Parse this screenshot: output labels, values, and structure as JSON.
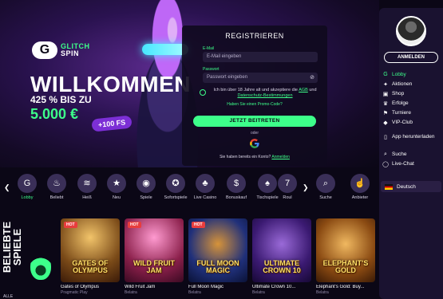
{
  "hero": {
    "logo_mark": "G",
    "logo_line1": "GLITCH",
    "logo_line2": "SPIN",
    "welcome": "WILLKOMMEN",
    "subtitle": "425 % BIS ZU",
    "amount": "5.000 €",
    "fs_badge": "+100 FS"
  },
  "register": {
    "title": "REGISTRIEREN",
    "email_label": "E-Mail",
    "email_placeholder": "E-Mail eingeben",
    "password_label": "Passwort",
    "password_placeholder": "Passwort eingeben",
    "consent_text": "Ich bin über 18 Jahre alt und akzeptiere die",
    "agb": "AGB",
    "and": "und",
    "privacy": "Datenschutz-Bestimmungen",
    "promo": "Haben Sie einen Promo-Code?",
    "cta": "JETZT BEITRETEN",
    "or": "oder",
    "have_account": "Sie haben bereits ein Konto?",
    "login": "Anmelden"
  },
  "sidebar": {
    "signin": "ANMELDEN",
    "items": [
      {
        "label": "Lobby",
        "icon": "lobby-icon",
        "glyph": "G"
      },
      {
        "label": "Aktionen",
        "icon": "gift-icon",
        "glyph": "✦"
      },
      {
        "label": "Shop",
        "icon": "shop-icon",
        "glyph": "▣"
      },
      {
        "label": "Erfolge",
        "icon": "trophy-icon",
        "glyph": "♛"
      },
      {
        "label": "Turniere",
        "icon": "tournament-icon",
        "glyph": "⚑"
      },
      {
        "label": "VIP-Club",
        "icon": "vip-icon",
        "glyph": "◆"
      },
      {
        "label": "App herunterladen",
        "icon": "download-app-icon",
        "glyph": "▯"
      },
      {
        "label": "Suche",
        "icon": "search-icon",
        "glyph": "⌕"
      },
      {
        "label": "Live-Chat",
        "icon": "chat-icon",
        "glyph": "◯"
      }
    ],
    "language": "Deutsch"
  },
  "categories": [
    {
      "label": "Lobby",
      "glyph": "G"
    },
    {
      "label": "Beliebt",
      "glyph": "♨"
    },
    {
      "label": "Heiß",
      "glyph": "≋"
    },
    {
      "label": "Neu",
      "glyph": "★"
    },
    {
      "label": "Spiele",
      "glyph": "◉"
    },
    {
      "label": "Sofortspiele",
      "glyph": "✪"
    },
    {
      "label": "Live Casino",
      "glyph": "♣"
    },
    {
      "label": "Bonuskauf",
      "glyph": "$"
    },
    {
      "label": "Tischspiele",
      "glyph": "♠"
    },
    {
      "label": "Roul",
      "glyph": "7"
    },
    {
      "label": "Suche",
      "glyph": "⌕"
    },
    {
      "label": "Anbieter",
      "glyph": "☝"
    }
  ],
  "popular": {
    "title_line1": "BELIEBTE",
    "title_line2": "SPIELE",
    "all": "ALLE",
    "games": [
      {
        "thumb_title": "GATES OF OLYMPUS",
        "name": "Gates of Olympus",
        "provider": "Pragmatic Play",
        "hot": "HOT",
        "bg": "#7a4a18"
      },
      {
        "thumb_title": "WILD FRUIT JAM",
        "name": "Wild Fruit Jam",
        "provider": "Belatra",
        "hot": "HOT",
        "bg": "#8a1f4a"
      },
      {
        "thumb_title": "FULL MOON MAGIC",
        "name": "Full Moon Magic",
        "provider": "Belatra",
        "hot": "HOT",
        "bg": "#20307a"
      },
      {
        "thumb_title": "ULTIMATE CROWN 10",
        "name": "Ultimate Crown 10...",
        "provider": "Belatra",
        "hot": "",
        "bg": "#3b1a72"
      },
      {
        "thumb_title": "ELEPHANT'S GOLD",
        "name": "Elephant's Gold: Buy...",
        "provider": "Belatra",
        "hot": "",
        "bg": "#8a4a12"
      }
    ]
  },
  "colors": {
    "accent": "#3dff8a",
    "background": "#0b0716",
    "sidebar": "#1a1230",
    "badge": "#7c2fd6"
  }
}
